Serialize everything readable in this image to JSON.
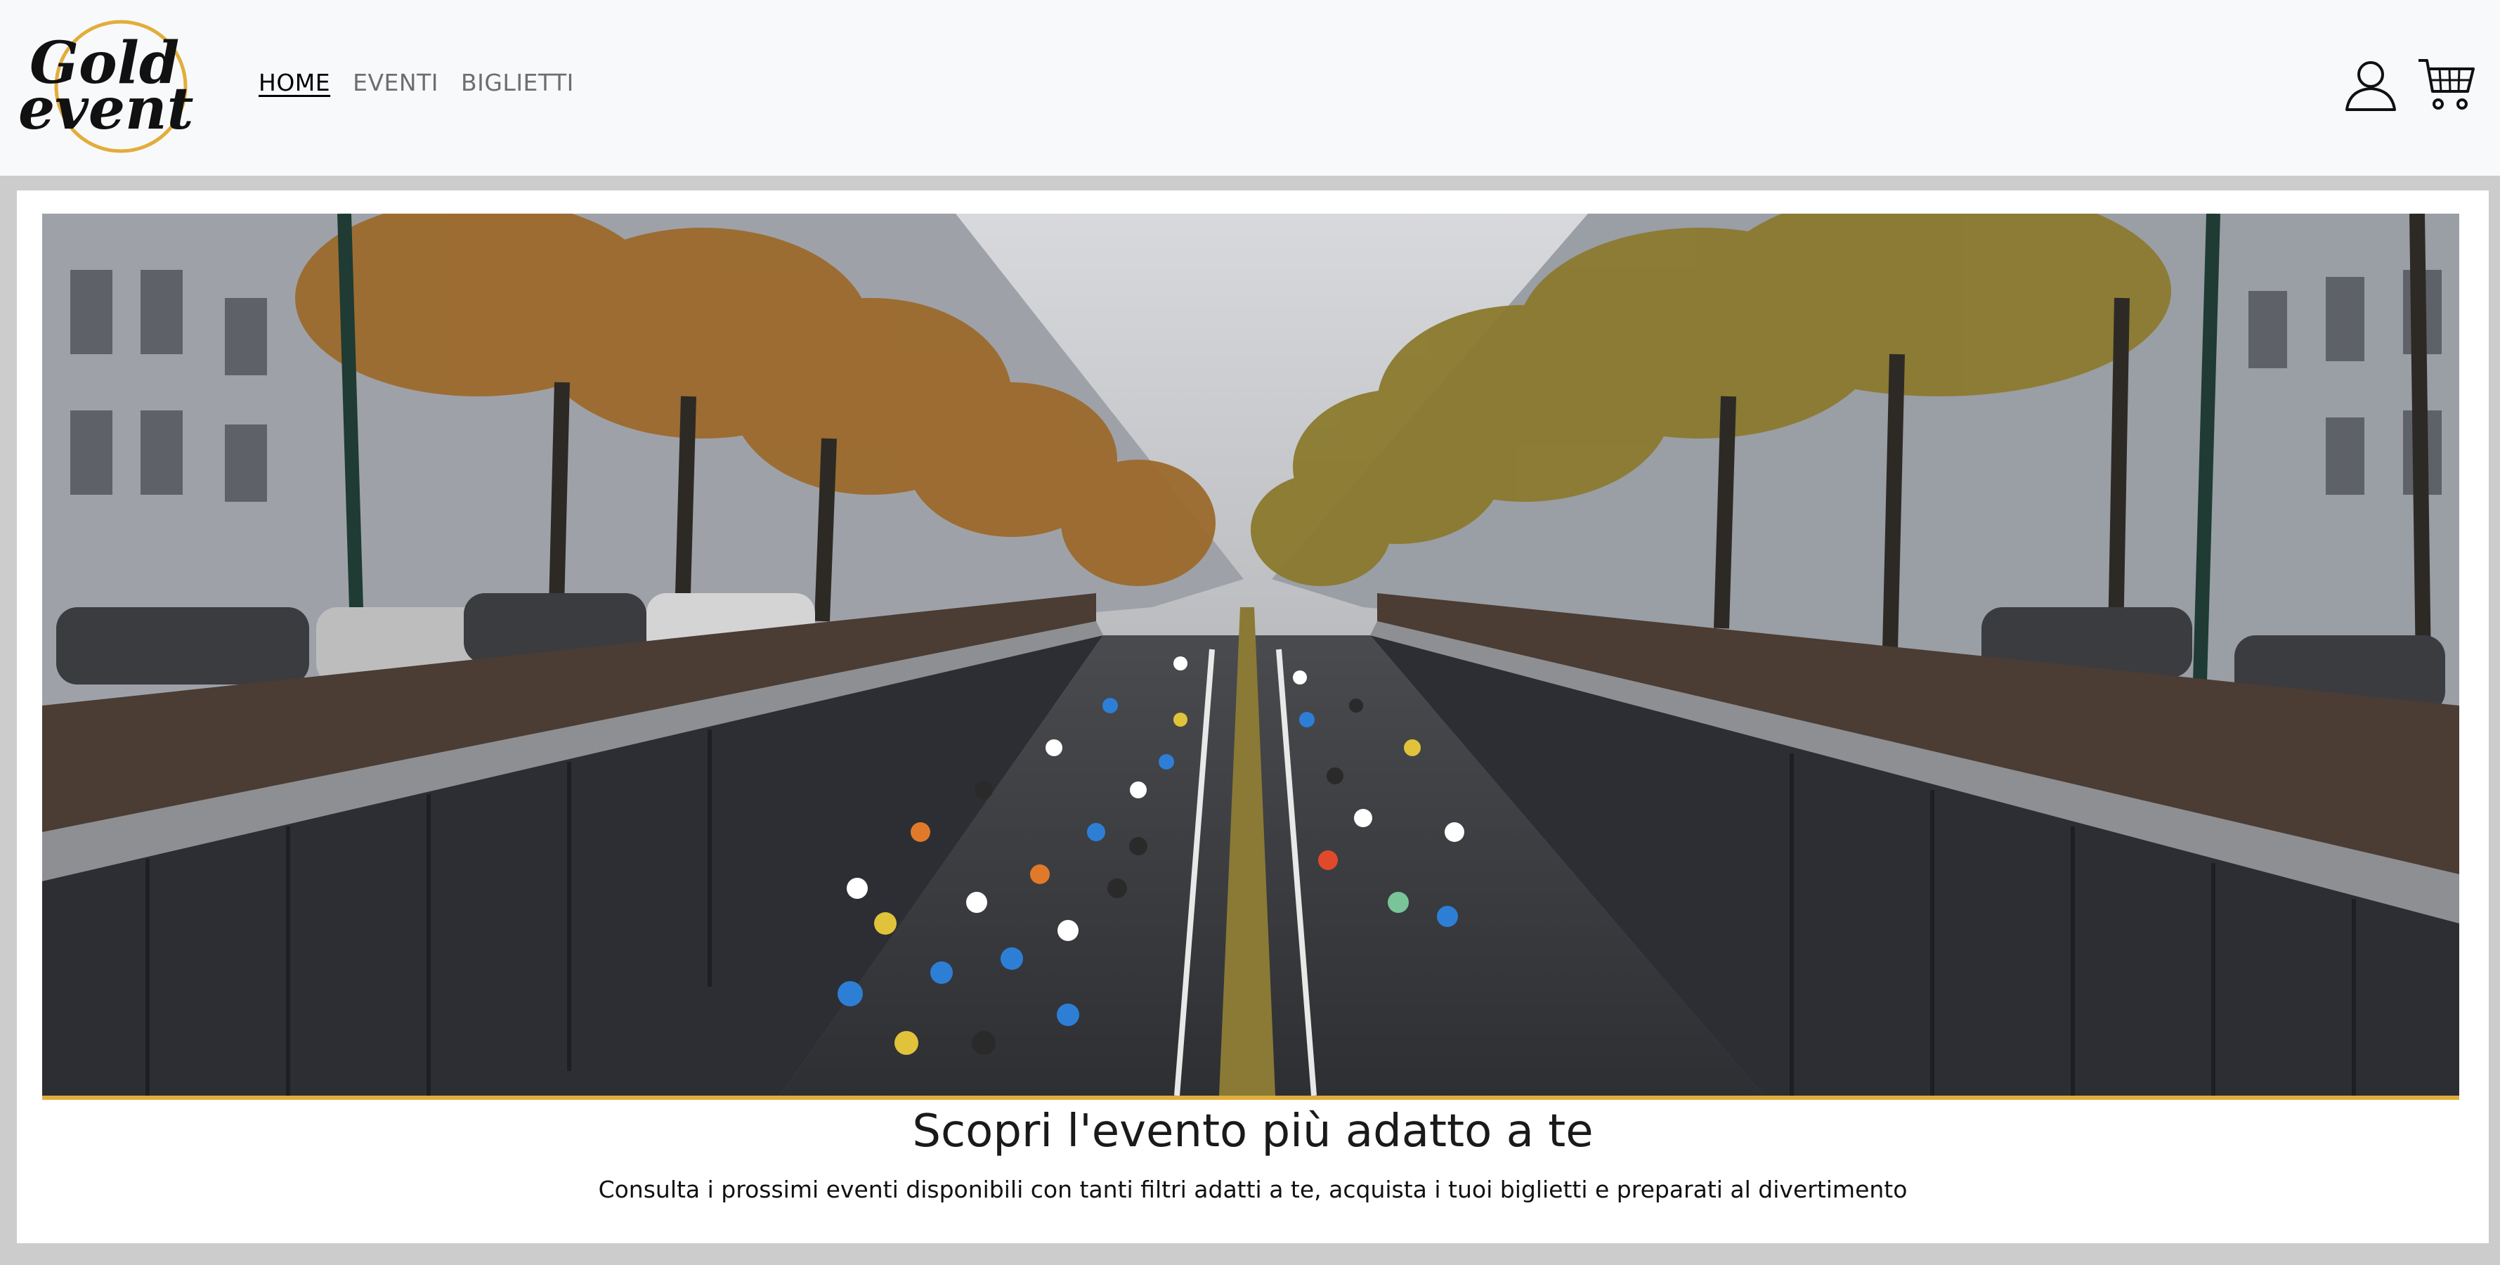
{
  "brand": {
    "logo_line1": "Gold",
    "logo_line2": "event",
    "ring_color": "#e2ad3a"
  },
  "nav": {
    "items": [
      {
        "label": "HOME",
        "active": true
      },
      {
        "label": "EVENTI",
        "active": false
      },
      {
        "label": "BIGLIETTI",
        "active": false
      }
    ]
  },
  "actions": {
    "user_icon": "user-icon",
    "cart_icon": "cart-icon"
  },
  "hero": {
    "image": "marathon runners running on a tree-lined city avenue",
    "title": "Scopri l'evento più adatto a te",
    "subtitle": "Consulta i prossimi eventi disponibili con tanti filtri adatti a te, acquista i tuoi biglietti e preparati al divertimento"
  },
  "colors": {
    "accent": "#e2ad3a",
    "navbar_bg": "#f8f9fb",
    "page_bg": "#cccccc"
  }
}
